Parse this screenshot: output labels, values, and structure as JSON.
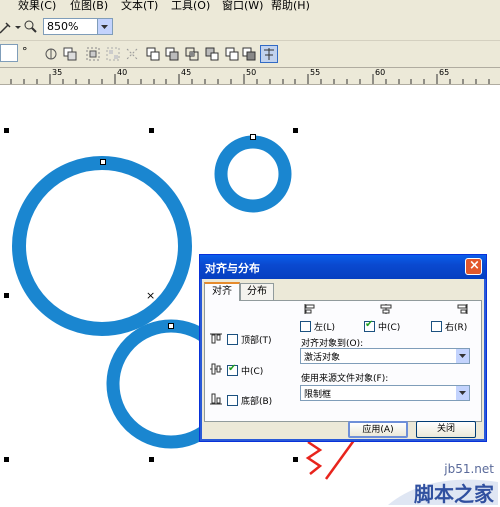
{
  "menu": {
    "items": [
      {
        "label": "效果(C)"
      },
      {
        "label": "位图(B)"
      },
      {
        "label": "文本(T)"
      },
      {
        "label": "工具(O)"
      },
      {
        "label": "窗口(W)"
      },
      {
        "label": "帮助(H)"
      }
    ]
  },
  "toolbar": {
    "zoom_value": "850%",
    "degree_symbol": "°"
  },
  "ruler": {
    "labels": [
      "35",
      "40",
      "45",
      "50",
      "55",
      "60",
      "65"
    ]
  },
  "canvas": {
    "ring_color": "#1a86d0",
    "center_marker": "×"
  },
  "dialog": {
    "title": "对齐与分布",
    "close_glyph": "×",
    "tabs": [
      {
        "label": "对齐"
      },
      {
        "label": "分布"
      }
    ],
    "horizontal": {
      "left_label": "左(L)",
      "center_label": "中(C)",
      "right_label": "右(R)",
      "center_checked": true
    },
    "align_to_label": "对齐对象到(O):",
    "align_to_value": "激活对象",
    "source_label": "使用来源文件对象(F):",
    "source_value": "限制框",
    "vertical": {
      "top_label": "顶部(T)",
      "center_label": "中(C)",
      "bottom_label": "底部(B)",
      "center_checked": true
    },
    "apply_label": "应用(A)",
    "close_label": "关闭"
  },
  "annotation_color": "#e8241c",
  "watermark": {
    "site": "jb51.net",
    "name": "脚本之家"
  }
}
